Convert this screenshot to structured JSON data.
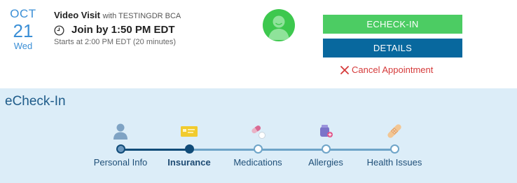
{
  "appointment": {
    "month": "OCT",
    "day": "21",
    "weekday": "Wed",
    "visit_type": "Video Visit",
    "with_text": "with TESTINGDR BCA",
    "join_text": "Join by 1:50 PM EDT",
    "starts_text": "Starts at 2:00 PM EDT (20 minutes)",
    "avatar_icon": "provider-avatar-icon"
  },
  "actions": {
    "echeck_label": "ECHECK-IN",
    "details_label": "DETAILS",
    "cancel_label": "Cancel Appointment"
  },
  "echeckin": {
    "title": "eCheck-In",
    "steps": [
      {
        "label": "Personal Info",
        "icon": "person-icon",
        "state": "visited"
      },
      {
        "label": "Insurance",
        "icon": "insurance-card-icon",
        "state": "current"
      },
      {
        "label": "Medications",
        "icon": "pills-icon",
        "state": "pending"
      },
      {
        "label": "Allergies",
        "icon": "allergy-icon",
        "state": "pending"
      },
      {
        "label": "Health Issues",
        "icon": "bandage-icon",
        "state": "pending"
      }
    ]
  },
  "colors": {
    "accent_blue": "#3b8fd6",
    "echeck_green": "#4ccc63",
    "details_blue": "#08689e",
    "cancel_red": "#d53a3a",
    "panel_bg": "#dcedf8",
    "progress_dark": "#114c79",
    "progress_light": "#6ea4c8"
  }
}
